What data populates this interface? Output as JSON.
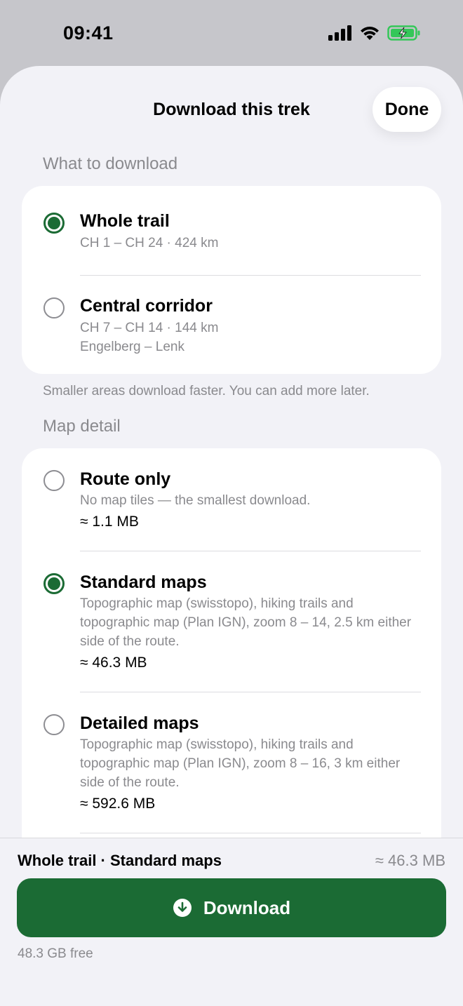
{
  "status_bar": {
    "time": "09:41"
  },
  "header": {
    "title": "Download this trek",
    "done_label": "Done"
  },
  "what_to_download": {
    "header": "What to download",
    "options": [
      {
        "title": "Whole trail",
        "subtitle": "CH 1 – CH 24 · 424 km",
        "selected": true
      },
      {
        "title": "Central corridor",
        "subtitle": "CH 7 – CH 14 · 144 km",
        "subtitle2": "Engelberg – Lenk",
        "selected": false
      }
    ],
    "footnote": "Smaller areas download faster. You can add more later."
  },
  "map_detail": {
    "header": "Map detail",
    "options": [
      {
        "title": "Route only",
        "description": "No map tiles — the smallest download.",
        "size": "≈ 1.1 MB",
        "selected": false
      },
      {
        "title": "Standard maps",
        "description": "Topographic map (swisstopo), hiking trails and topographic map (Plan IGN), zoom 8 – 14, 2.5 km either side of the route.",
        "size": "≈ 46.3 MB",
        "selected": true
      },
      {
        "title": "Detailed maps",
        "description": "Topographic map (swisstopo), hiking trails and topographic map (Plan IGN), zoom 8 – 16, 3 km either side of the route.",
        "size": "≈ 592.6 MB",
        "selected": false
      }
    ]
  },
  "bottom_bar": {
    "summary": "Whole trail · Standard maps",
    "summary_size": "≈ 46.3 MB",
    "download_label": "Download",
    "free_space": "48.3 GB free"
  },
  "colors": {
    "accent": "#1b6b34",
    "secondary_text": "#8a8a8e",
    "sheet_bg": "#f2f2f7"
  }
}
